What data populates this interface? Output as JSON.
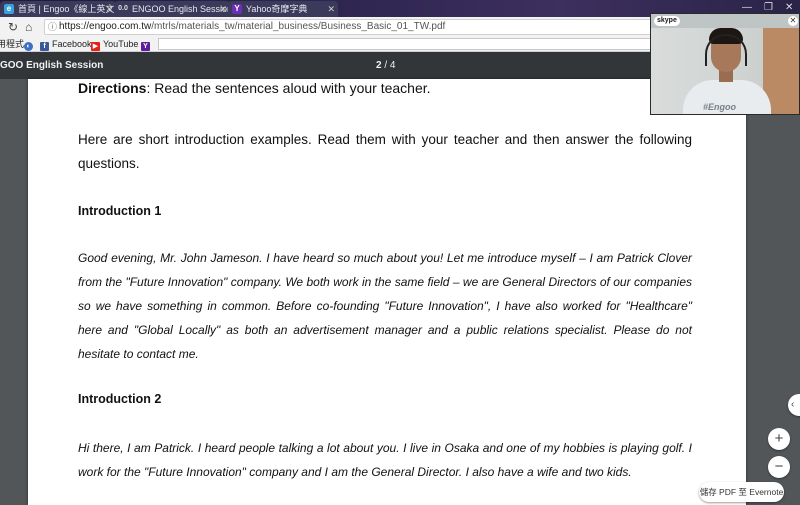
{
  "tabs": [
    {
      "label": "首頁 | Engoo《線上英文",
      "favicon": "engoo-icon"
    },
    {
      "label": "ENGOO English Session",
      "favicon": "engoo-oo-icon"
    },
    {
      "label": "Yahoo奇摩字典",
      "favicon": "yahoo-icon"
    }
  ],
  "addressbar": {
    "url_host": "https://engoo.com.tw",
    "url_path": "/mtrls/materials_tw/material_business/Business_Basic_01_TW.pdf"
  },
  "bookmarks": [
    {
      "label": "應用程式",
      "icon": "apps-icon"
    },
    {
      "label": "",
      "icon": "globe-icon"
    },
    {
      "label": "Facebook",
      "icon": "facebook-icon"
    },
    {
      "label": "YouTube",
      "icon": "youtube-icon"
    },
    {
      "label": "",
      "icon": "yahoo-icon"
    }
  ],
  "pdf": {
    "title": "GOO English Session",
    "current_page": "2",
    "total_pages": "4",
    "page_sep": "/"
  },
  "document": {
    "directions_label": "Directions",
    "directions_text": ": Read the sentences aloud with your teacher.",
    "intro_text": "Here are short introduction examples. Read them with your teacher and then answer the following questions.",
    "sections": [
      {
        "heading": "Introduction 1",
        "body": "Good evening, Mr. John Jameson. I have heard so much about you! Let me introduce myself – I am Patrick Clover from the \"Future Innovation\" company. We both work in the same field – we are General Directors of our companies so we have something in common. Before co-founding \"Future Innovation\", I have also worked for \"Healthcare\" here and \"Global Locally\" as both an advertisement manager and a public relations specialist. Please do not hesitate to contact me."
      },
      {
        "heading": "Introduction 2",
        "body": "Hi there, I am Patrick. I heard people talking a lot about you. I live in Osaka and one of my hobbies is playing golf. I work for the \"Future Innovation\" company and I am the General Director. I also have a wife and two kids."
      }
    ]
  },
  "skype": {
    "logo": "skype",
    "shirt_text": "#Engoo"
  },
  "controls": {
    "zoom_in": "+",
    "zoom_out": "−",
    "side_tab": "‹",
    "evernote_label": "儲存 PDF 至 Evernote"
  }
}
